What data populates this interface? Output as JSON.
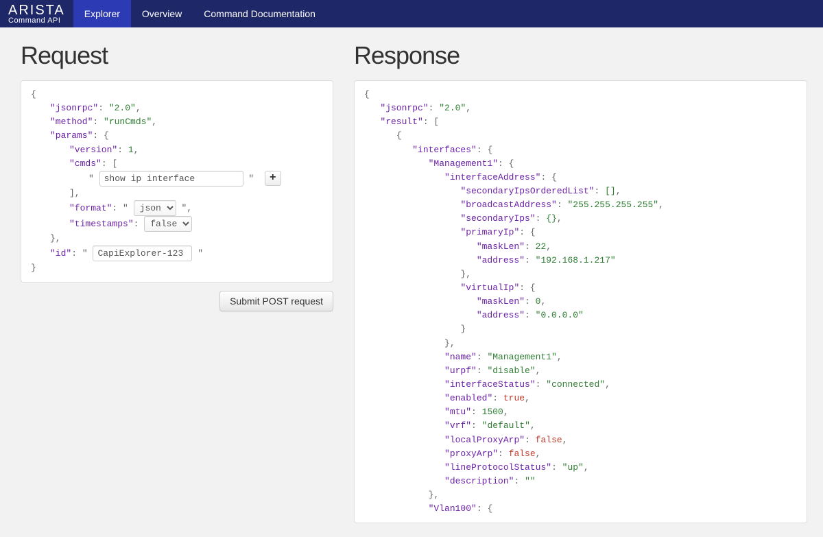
{
  "nav": {
    "brand_top": "ARISTA",
    "brand_sub": "Command API",
    "items": [
      "Explorer",
      "Overview",
      "Command Documentation"
    ],
    "active_index": 0
  },
  "headings": {
    "request": "Request",
    "response": "Response"
  },
  "request": {
    "keys": {
      "jsonrpc": "\"jsonrpc\"",
      "method": "\"method\"",
      "params": "\"params\"",
      "version": "\"version\"",
      "cmds": "\"cmds\"",
      "format": "\"format\"",
      "timestamps": "\"timestamps\"",
      "id": "\"id\""
    },
    "vals": {
      "jsonrpc": "\"2.0\"",
      "method": "\"runCmds\"",
      "version": "1"
    },
    "cmd_input": "show ip interface",
    "format_options": [
      "json"
    ],
    "format_selected": "json",
    "timestamps_options": [
      "false"
    ],
    "timestamps_selected": "false",
    "id_value": "CapiExplorer-123",
    "plus_label": "+",
    "submit_label": "Submit POST request"
  },
  "response": {
    "lines": [
      [
        0,
        "p",
        "{"
      ],
      [
        1,
        "kv",
        "\"jsonrpc\"",
        "\"2.0\"",
        ","
      ],
      [
        1,
        "ko",
        "\"result\"",
        "["
      ],
      [
        2,
        "p",
        "{"
      ],
      [
        3,
        "ko",
        "\"interfaces\"",
        "{"
      ],
      [
        4,
        "ko",
        "\"Management1\"",
        "{"
      ],
      [
        5,
        "ko",
        "\"interfaceAddress\"",
        "{"
      ],
      [
        6,
        "kv",
        "\"secondaryIpsOrderedList\"",
        "[]",
        ","
      ],
      [
        6,
        "kv",
        "\"broadcastAddress\"",
        "\"255.255.255.255\"",
        ","
      ],
      [
        6,
        "kv",
        "\"secondaryIps\"",
        "{}",
        ","
      ],
      [
        6,
        "ko",
        "\"primaryIp\"",
        "{"
      ],
      [
        7,
        "kn",
        "\"maskLen\"",
        "22",
        ","
      ],
      [
        7,
        "kv",
        "\"address\"",
        "\"192.168.1.217\"",
        ""
      ],
      [
        6,
        "p",
        "},"
      ],
      [
        6,
        "ko",
        "\"virtualIp\"",
        "{"
      ],
      [
        7,
        "kn",
        "\"maskLen\"",
        "0",
        ","
      ],
      [
        7,
        "kv",
        "\"address\"",
        "\"0.0.0.0\"",
        ""
      ],
      [
        6,
        "p",
        "}"
      ],
      [
        5,
        "p",
        "},"
      ],
      [
        5,
        "kv",
        "\"name\"",
        "\"Management1\"",
        ","
      ],
      [
        5,
        "kv",
        "\"urpf\"",
        "\"disable\"",
        ","
      ],
      [
        5,
        "kv",
        "\"interfaceStatus\"",
        "\"connected\"",
        ","
      ],
      [
        5,
        "kb",
        "\"enabled\"",
        "true",
        ","
      ],
      [
        5,
        "kn",
        "\"mtu\"",
        "1500",
        ","
      ],
      [
        5,
        "kv",
        "\"vrf\"",
        "\"default\"",
        ","
      ],
      [
        5,
        "kb",
        "\"localProxyArp\"",
        "false",
        ","
      ],
      [
        5,
        "kb",
        "\"proxyArp\"",
        "false",
        ","
      ],
      [
        5,
        "kv",
        "\"lineProtocolStatus\"",
        "\"up\"",
        ","
      ],
      [
        5,
        "kv",
        "\"description\"",
        "\"\"",
        ""
      ],
      [
        4,
        "p",
        "},"
      ],
      [
        4,
        "ko",
        "\"Vlan100\"",
        "{"
      ]
    ]
  }
}
